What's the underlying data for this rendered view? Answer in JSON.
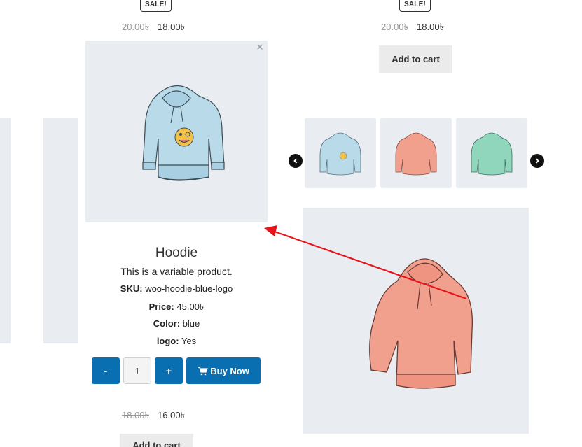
{
  "top_products": [
    {
      "badge": "SALE!",
      "old_price": "20.00৳",
      "new_price": "18.00৳"
    },
    {
      "badge": "SALE!",
      "old_price": "20.00৳",
      "new_price": "18.00৳",
      "button": "Add to cart"
    }
  ],
  "quick_view": {
    "close_icon": "×",
    "title": "Hoodie",
    "description": "This is a variable product.",
    "sku_label": "SKU:",
    "sku": "woo-hoodie-blue-logo",
    "price_label": "Price:",
    "price": "45.00৳",
    "color_label": "Color:",
    "color": "blue",
    "logo_label": "logo:",
    "logo": "Yes",
    "minus_label": "-",
    "quantity": "1",
    "plus_label": "+",
    "buy_now_label": "Buy Now"
  },
  "gallery": {
    "thumbnails": [
      "blue-hoodie-logo",
      "pink-hoodie",
      "green-hoodie"
    ],
    "prev_icon": "chevron-left-icon",
    "next_icon": "chevron-right-icon"
  },
  "bottom_product": {
    "old_price": "18.00৳",
    "new_price": "16.00৳",
    "button": "Add to cart"
  },
  "colors": {
    "accent_blue": "#0a6fb0",
    "panel": "#e9edf1",
    "arrow_red": "#e8141b"
  }
}
